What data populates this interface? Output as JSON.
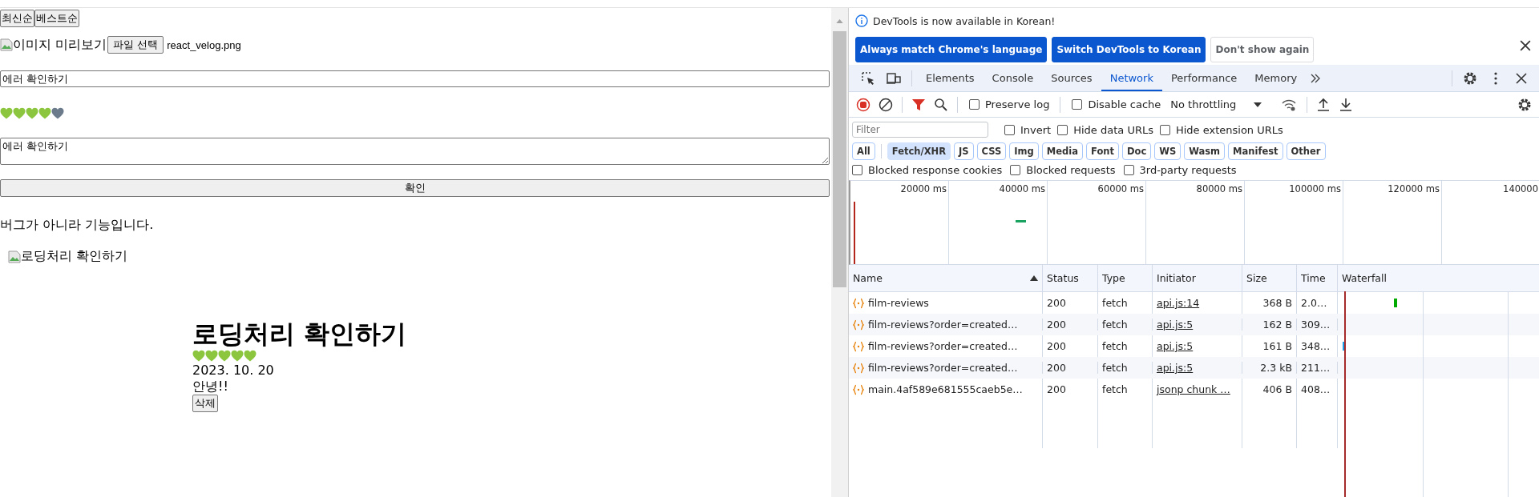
{
  "page": {
    "sort_buttons": [
      {
        "label": "최신순"
      },
      {
        "label": "베스트순"
      }
    ],
    "image_alt": "이미지 미리보기",
    "file_button": "파일 선택",
    "file_name": "react_velog.png",
    "title_input": "에러 확인하기",
    "rating": {
      "stars": 4
    },
    "content_textarea": "에러 확인하기",
    "submit_button": "확인",
    "message": "버그가 아니라 기능입니다.",
    "review": {
      "image_alt": "로딩처리 확인하기",
      "title": "로딩처리 확인하기",
      "rating": {
        "stars": 5
      },
      "date": "2023. 10. 20",
      "content": "안녕!!",
      "delete_button": "삭제"
    }
  },
  "devtools": {
    "infobar": {
      "message": "DevTools is now available in Korean!",
      "buttons": [
        {
          "label": "Always match Chrome's language",
          "kind": "primary"
        },
        {
          "label": "Switch DevTools to Korean",
          "kind": "primary"
        },
        {
          "label": "Don't show again",
          "kind": "secondary"
        }
      ]
    },
    "tabs": [
      {
        "label": "Elements",
        "selected": false
      },
      {
        "label": "Console",
        "selected": false
      },
      {
        "label": "Sources",
        "selected": false
      },
      {
        "label": "Network",
        "selected": true
      },
      {
        "label": "Performance",
        "selected": false
      },
      {
        "label": "Memory",
        "selected": false
      }
    ],
    "toolbar": {
      "options": [
        {
          "label": "Preserve log",
          "checked": false
        },
        {
          "label": "Disable cache",
          "checked": false
        }
      ],
      "throttling": "No throttling"
    },
    "filter": {
      "placeholder": "Filter",
      "options": [
        {
          "label": "Invert",
          "checked": false
        },
        {
          "label": "Hide data URLs",
          "checked": false
        },
        {
          "label": "Hide extension URLs",
          "checked": false
        }
      ]
    },
    "type_filters": [
      {
        "label": "All",
        "selected": false
      },
      {
        "label": "Fetch/XHR",
        "selected": true
      },
      {
        "label": "JS",
        "selected": false
      },
      {
        "label": "CSS",
        "selected": false
      },
      {
        "label": "Img",
        "selected": false
      },
      {
        "label": "Media",
        "selected": false
      },
      {
        "label": "Font",
        "selected": false
      },
      {
        "label": "Doc",
        "selected": false
      },
      {
        "label": "WS",
        "selected": false
      },
      {
        "label": "Wasm",
        "selected": false
      },
      {
        "label": "Manifest",
        "selected": false
      },
      {
        "label": "Other",
        "selected": false
      }
    ],
    "blocked_options": [
      {
        "label": "Blocked response cookies",
        "checked": false
      },
      {
        "label": "Blocked requests",
        "checked": false
      },
      {
        "label": "3rd-party requests",
        "checked": false
      }
    ],
    "overview": {
      "ticks": [
        "20000 ms",
        "40000 ms",
        "60000 ms",
        "80000 ms",
        "100000 ms",
        "120000 ms",
        "140000"
      ]
    },
    "table": {
      "columns": [
        "Name",
        "Status",
        "Type",
        "Initiator",
        "Size",
        "Time",
        "Waterfall"
      ],
      "rows": [
        {
          "name": "film-reviews",
          "status": "200",
          "type": "fetch",
          "initiator": "api.js:14",
          "size": "368 B",
          "time": "2.0…"
        },
        {
          "name": "film-reviews?order=created…",
          "status": "200",
          "type": "fetch",
          "initiator": "api.js:5",
          "size": "162 B",
          "time": "309…"
        },
        {
          "name": "film-reviews?order=created…",
          "status": "200",
          "type": "fetch",
          "initiator": "api.js:5",
          "size": "161 B",
          "time": "348…"
        },
        {
          "name": "film-reviews?order=created…",
          "status": "200",
          "type": "fetch",
          "initiator": "api.js:5",
          "size": "2.3 kB",
          "time": "211…"
        },
        {
          "name": "main.4af589e681555caeb5e…",
          "status": "200",
          "type": "fetch",
          "initiator": "jsonp chunk …",
          "size": "406 B",
          "time": "408…"
        }
      ]
    }
  }
}
